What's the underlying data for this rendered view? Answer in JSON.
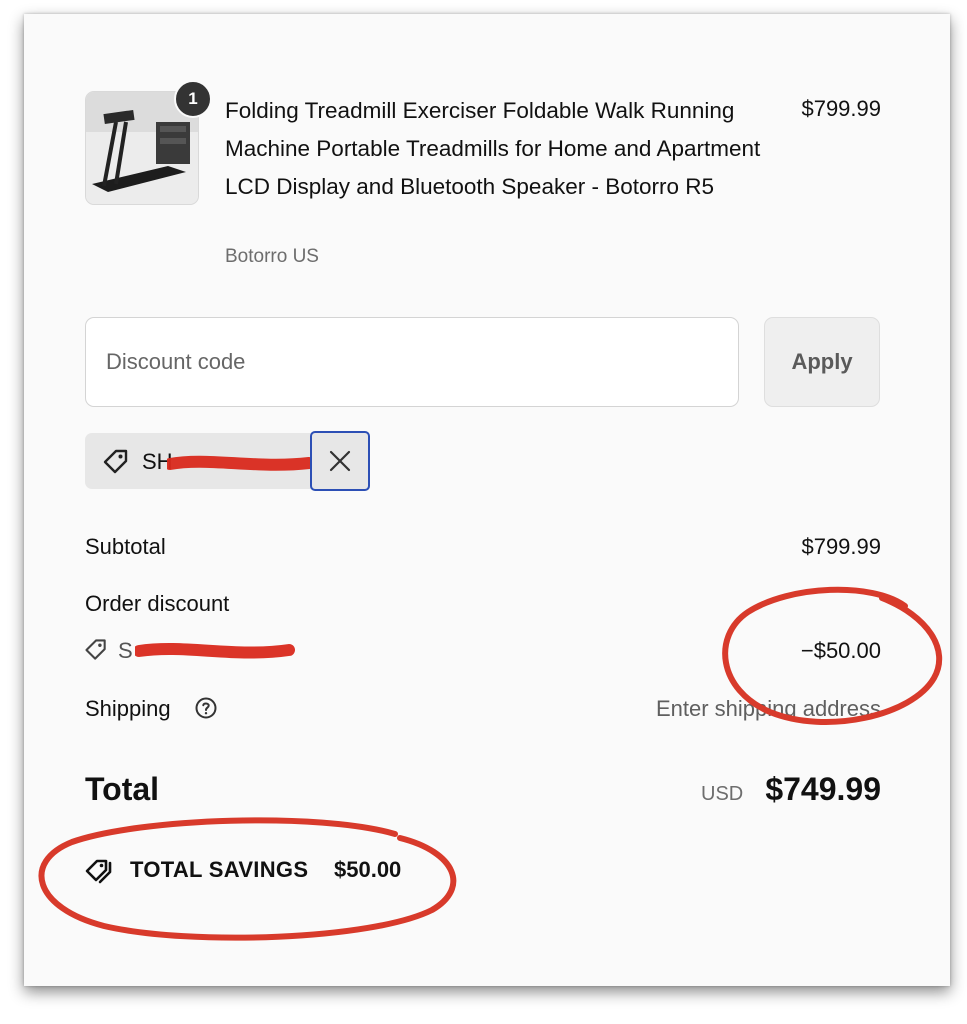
{
  "product": {
    "title": "Folding Treadmill Exerciser Foldable Walk Running Machine Portable Treadmills for Home and Apartment LCD Display and Bluetooth Speaker - Botorro R5",
    "vendor": "Botorro US",
    "price": "$799.99",
    "quantity": "1",
    "image_icon": "treadmill-product-image"
  },
  "discount": {
    "placeholder": "Discount code",
    "apply_label": "Apply",
    "applied_code_visible": "SH",
    "remove_icon": "close-icon"
  },
  "summary": {
    "subtotal_label": "Subtotal",
    "subtotal_value": "$799.99",
    "order_discount_label": "Order discount",
    "order_discount_code_visible": "S",
    "order_discount_value": "−$50.00",
    "shipping_label": "Shipping",
    "shipping_value": "Enter shipping address",
    "total_label": "Total",
    "currency": "USD",
    "total_value": "$749.99",
    "savings_label": "TOTAL SAVINGS",
    "savings_value": "$50.00"
  },
  "colors": {
    "annotation_red": "#d83a2b",
    "focus_blue": "#2c4fb5",
    "redaction_red": "#d9291c"
  }
}
